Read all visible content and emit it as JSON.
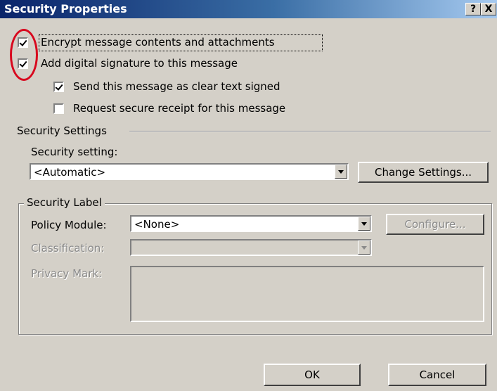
{
  "window": {
    "title": "Security Properties",
    "help_label": "?",
    "close_label": "X"
  },
  "options": {
    "encrypt_label": "Encrypt message contents and attachments",
    "encrypt_checked": true,
    "signature_label": "Add digital signature to this message",
    "signature_checked": true,
    "clear_text_label": "Send this message as clear text signed",
    "clear_text_checked": true,
    "receipt_label": "Request secure receipt for this message",
    "receipt_checked": false
  },
  "security_settings": {
    "group_label": "Security Settings",
    "setting_label": "Security setting:",
    "setting_value": "<Automatic>",
    "change_button": "Change Settings..."
  },
  "security_label": {
    "group_label": "Security Label",
    "policy_label": "Policy Module:",
    "policy_value": "<None>",
    "configure_button": "Configure...",
    "classification_label": "Classification:",
    "classification_value": "",
    "privacy_label": "Privacy Mark:",
    "privacy_value": ""
  },
  "footer": {
    "ok_button": "OK",
    "cancel_button": "Cancel"
  },
  "colors": {
    "dialog_bg": "#d4d0c8",
    "title_start": "#0a246a",
    "title_end": "#a6caf0",
    "annotation_circle": "#d8081e"
  }
}
